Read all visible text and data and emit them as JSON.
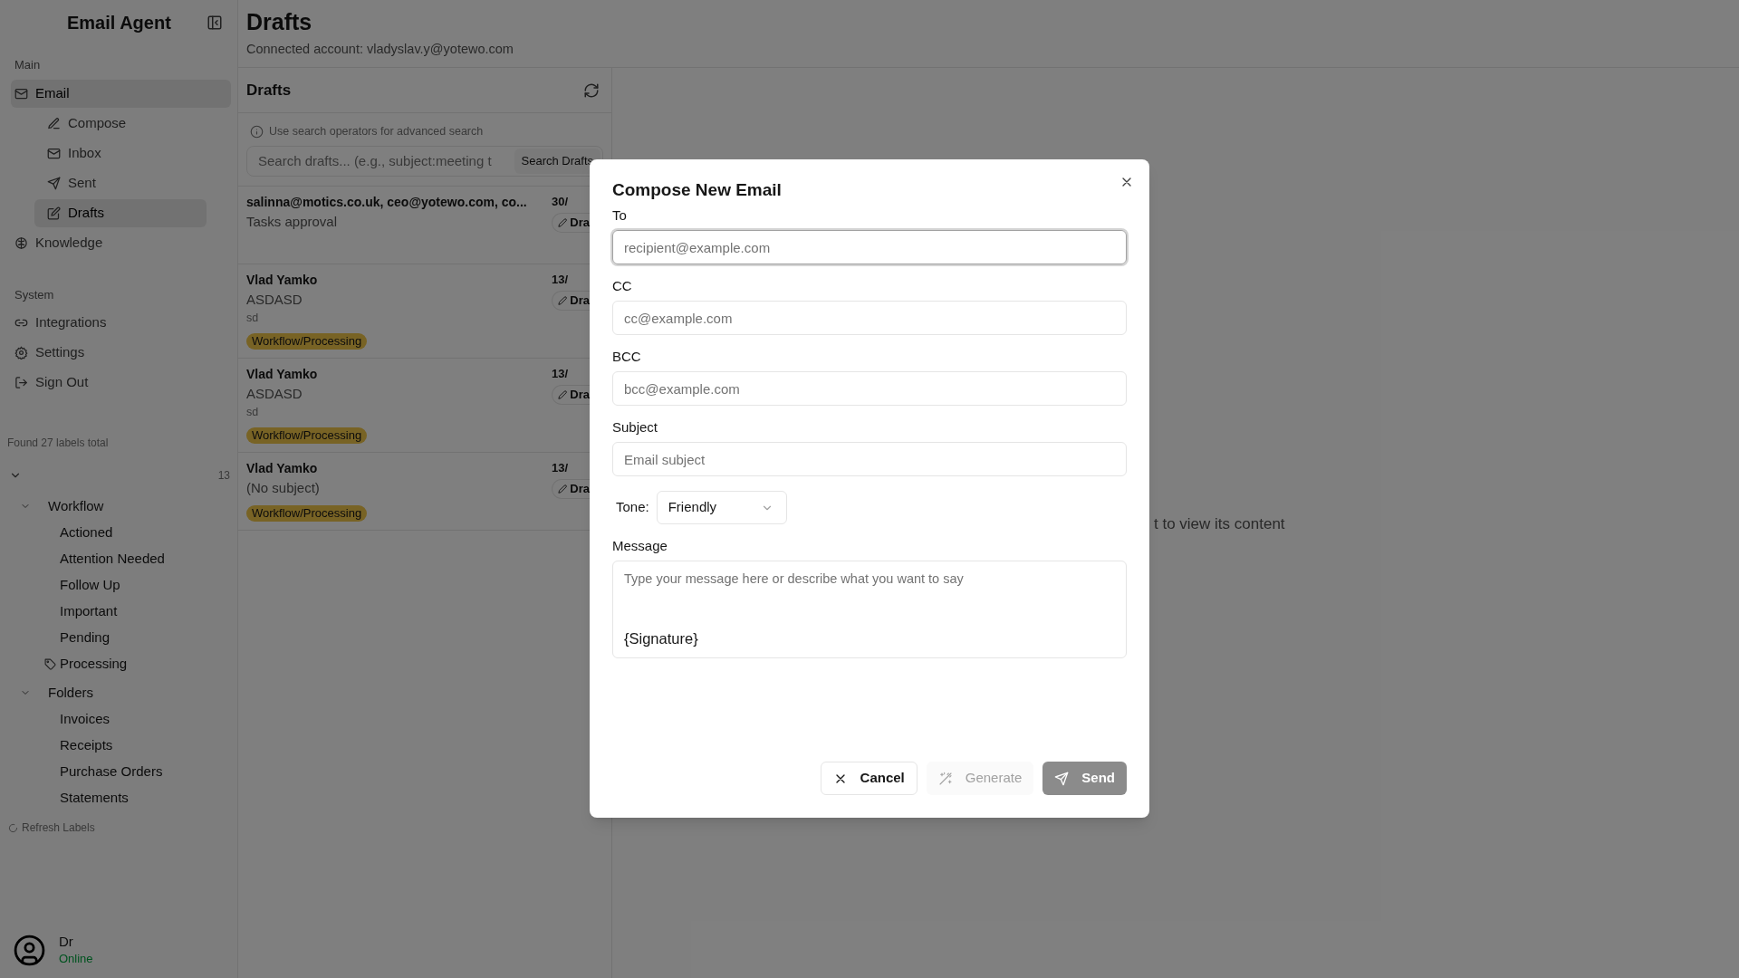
{
  "app": {
    "title": "Email Agent"
  },
  "sidebar": {
    "sections": [
      {
        "heading": "Main",
        "items": [
          {
            "label": "Email",
            "selected": true,
            "children": [
              {
                "label": "Compose",
                "selected": false
              },
              {
                "label": "Inbox",
                "selected": false
              },
              {
                "label": "Sent",
                "selected": false
              },
              {
                "label": "Drafts",
                "selected": true
              }
            ]
          },
          {
            "label": "Knowledge",
            "selected": false
          }
        ]
      },
      {
        "heading": "System",
        "items": [
          {
            "label": "Integrations",
            "selected": false
          },
          {
            "label": "Settings",
            "selected": false
          },
          {
            "label": "Sign Out",
            "selected": false
          }
        ]
      }
    ]
  },
  "labels": {
    "summary": "Found 27 labels total",
    "count": "13",
    "expanded": true,
    "children": [
      {
        "label": "Workflow",
        "expanded": true,
        "children": [
          {
            "label": "Actioned",
            "kind": "plain"
          },
          {
            "label": "Attention Needed",
            "kind": "plain"
          },
          {
            "label": "Follow Up",
            "kind": "plain"
          },
          {
            "label": "Important",
            "kind": "plain"
          },
          {
            "label": "Pending",
            "kind": "plain"
          },
          {
            "label": "Processing",
            "kind": "tag"
          }
        ]
      },
      {
        "label": "Folders",
        "expanded": true,
        "children": [
          {
            "label": "Invoices",
            "kind": "plain"
          },
          {
            "label": "Receipts",
            "kind": "plain"
          },
          {
            "label": "Purchase Orders",
            "kind": "plain"
          },
          {
            "label": "Statements",
            "kind": "plain"
          }
        ]
      }
    ],
    "refresh": "Refresh Labels"
  },
  "user": {
    "name": "Dr",
    "status": "Online"
  },
  "page": {
    "title": "Drafts",
    "subtitle": "Connected account: vladyslav.y@yotewo.com"
  },
  "drafts": {
    "title": "Drafts",
    "hint": "Use search operators for advanced search",
    "search": {
      "placeholder": "Search drafts... (e.g., subject:meeting t",
      "button": "Search Drafts"
    },
    "items": [
      {
        "sender": "salinna@motics.co.uk, ceo@yotewo.com, co...",
        "subject": "Tasks approval",
        "date": "30/",
        "badge": "Dra"
      },
      {
        "sender": "Vlad Yamko",
        "subject": "ASDASD",
        "snippet": "sd",
        "date": "13/",
        "badge": "Dra",
        "tag": "Workflow/Processing"
      },
      {
        "sender": "Vlad Yamko",
        "subject": "ASDASD",
        "snippet": "sd",
        "date": "13/",
        "badge": "Dra",
        "tag": "Workflow/Processing"
      },
      {
        "sender": "Vlad Yamko",
        "subject": "(No subject)",
        "date": "13/",
        "badge": "Dra",
        "tag": "Workflow/Processing"
      }
    ]
  },
  "empty_hint": "t to view its content",
  "modal": {
    "title": "Compose New Email",
    "fields": [
      {
        "label": "To",
        "placeholder": "recipient@example.com",
        "focused": true
      },
      {
        "label": "CC",
        "placeholder": "cc@example.com",
        "focused": false
      },
      {
        "label": "BCC",
        "placeholder": "bcc@example.com",
        "focused": false
      },
      {
        "label": "Subject",
        "placeholder": "Email subject",
        "focused": false
      }
    ],
    "tone": {
      "label": "Tone:",
      "value": "Friendly"
    },
    "message": {
      "label": "Message",
      "placeholder": "Type your message here or describe what you want to say",
      "signature": "{Signature}"
    },
    "buttons": [
      {
        "label": "Cancel",
        "kind": "cancel",
        "disabled": false
      },
      {
        "label": "Generate",
        "kind": "generate",
        "disabled": true
      },
      {
        "label": "Send",
        "kind": "send",
        "disabled": true
      }
    ]
  }
}
